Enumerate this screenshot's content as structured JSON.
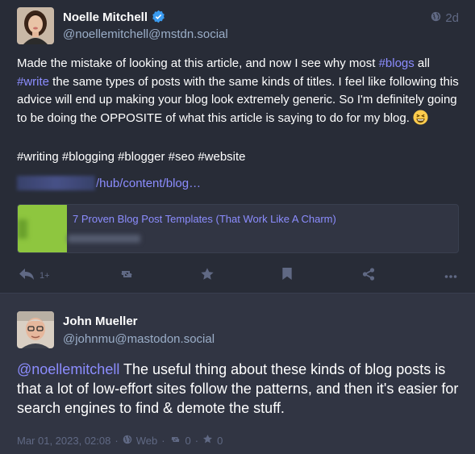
{
  "post1": {
    "author": {
      "display_name": "Noelle Mitchell",
      "handle": "@noellemitchell@mstdn.social",
      "verified": true
    },
    "visibility_icon": "globe-icon",
    "time": "2d",
    "content": {
      "line_before_tag1": "Made the mistake of looking at this article, and now I see why most ",
      "tag1": "#blogs",
      "after_tag1": " all",
      "tag2": "#write",
      "after_tag2": " the same types of posts with the same kinds of titles. I feel like following this advice will end up making your blog look extremely generic. So I'm definitely going to be doing the OPPOSITE of what this article is saying to do for my blog.",
      "emoji": "grinning-squinting-face",
      "hashtags_line": "#writing #blogging #blogger #seo #website",
      "link_text": "/hub/content/blog…"
    },
    "card": {
      "title": "7 Proven Blog Post Templates (That Work Like A Charm)"
    },
    "actions": {
      "reply_count": "1+",
      "reply_icon": "reply-icon",
      "boost_icon": "boost-icon",
      "favourite_icon": "star-icon",
      "bookmark_icon": "bookmark-icon",
      "share_icon": "share-icon",
      "more_icon": "more-icon"
    }
  },
  "post2": {
    "author": {
      "display_name": "John Mueller",
      "handle": "@johnmu@mastodon.social"
    },
    "content": {
      "mention": "@noellemitchell",
      "text": " The useful thing about these kinds of blog posts is that a lot of low-effort sites follow the patterns, and then it's easier for search engines to find & demote the stuff."
    },
    "footer": {
      "date": "Mar 01, 2023, 02:08",
      "sep1": "·",
      "visibility": "Web",
      "sep2": "·",
      "boosts": "0",
      "sep3": "·",
      "favourites": "0"
    }
  },
  "colors": {
    "background": "#282c37",
    "thread_background": "#313543",
    "link": "#8c8dff",
    "muted": "#606984",
    "handle": "#9baec8",
    "verified": "#3a9bf0"
  }
}
